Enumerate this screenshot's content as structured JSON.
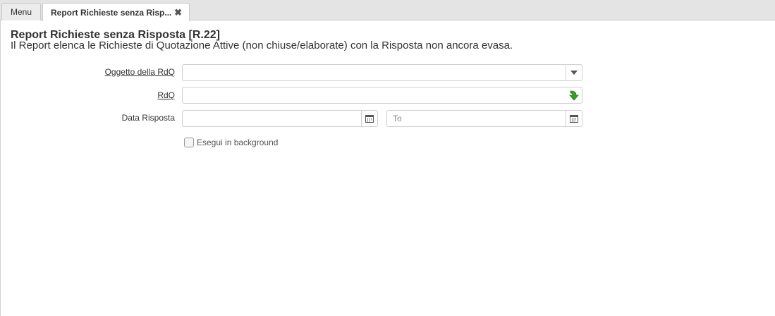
{
  "tabs": [
    {
      "label": "Menu",
      "active": false
    },
    {
      "label": "Report Richieste senza Risp...",
      "active": true
    }
  ],
  "page": {
    "title": "Report Richieste senza Risposta [R.22]",
    "description": "Il Report elenca le Richieste di Quotazione Attive (non chiuse/elaborate) con la Risposta non ancora evasa."
  },
  "form": {
    "oggetto": {
      "label": "Oggetto della RdQ",
      "value": "",
      "icon": "chevron-down-icon"
    },
    "rdq": {
      "label": "RdQ",
      "value": "",
      "icon": "green-arrow-zoom-icon"
    },
    "data_risposta": {
      "label": "Data Risposta",
      "from_value": "",
      "to_placeholder": "To",
      "icon": "calendar-icon"
    },
    "background": {
      "label": "Esegui in background",
      "checked": false
    }
  },
  "colors": {
    "tabbar": "#e4e4e4",
    "border": "#cfcfcf",
    "zoom_green": "#3a9a2a"
  }
}
